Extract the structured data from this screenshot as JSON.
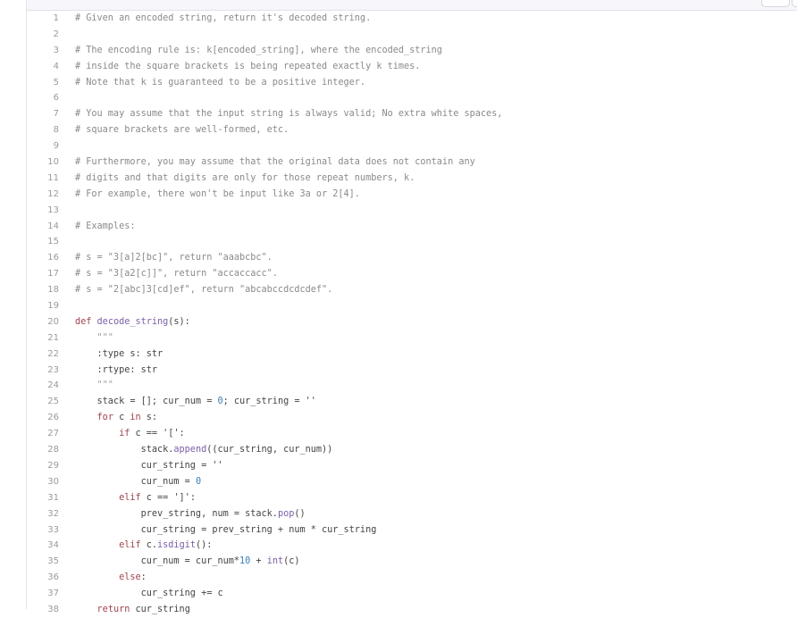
{
  "editor": {
    "language": "python",
    "colors": {
      "comment": "#8a8a8a",
      "keyword": "#a1434f",
      "function": "#7b5ea7",
      "number": "#3b7fb8",
      "text": "#444444",
      "line_number": "#9a9a9a",
      "header_bg": "#f6f6fb"
    },
    "lines": [
      {
        "n": "1",
        "text": "# Given an encoded string, return it's decoded string."
      },
      {
        "n": "2",
        "text": ""
      },
      {
        "n": "3",
        "text": "# The encoding rule is: k[encoded_string], where the encoded_string"
      },
      {
        "n": "4",
        "text": "# inside the square brackets is being repeated exactly k times."
      },
      {
        "n": "5",
        "text": "# Note that k is guaranteed to be a positive integer."
      },
      {
        "n": "6",
        "text": ""
      },
      {
        "n": "7",
        "text": "# You may assume that the input string is always valid; No extra white spaces,"
      },
      {
        "n": "8",
        "text": "# square brackets are well-formed, etc."
      },
      {
        "n": "9",
        "text": ""
      },
      {
        "n": "10",
        "text": "# Furthermore, you may assume that the original data does not contain any"
      },
      {
        "n": "11",
        "text": "# digits and that digits are only for those repeat numbers, k."
      },
      {
        "n": "12",
        "text": "# For example, there won't be input like 3a or 2[4]."
      },
      {
        "n": "13",
        "text": ""
      },
      {
        "n": "14",
        "text": "# Examples:"
      },
      {
        "n": "15",
        "text": ""
      },
      {
        "n": "16",
        "text": "# s = \"3[a]2[bc]\", return \"aaabcbc\"."
      },
      {
        "n": "17",
        "text": "# s = \"3[a2[c]]\", return \"accaccacc\"."
      },
      {
        "n": "18",
        "text": "# s = \"2[abc]3[cd]ef\", return \"abcabccdcdcdef\"."
      },
      {
        "n": "19",
        "text": ""
      },
      {
        "n": "20",
        "text": "def decode_string(s):"
      },
      {
        "n": "21",
        "text": "    \"\"\""
      },
      {
        "n": "22",
        "text": "    :type s: str"
      },
      {
        "n": "23",
        "text": "    :rtype: str"
      },
      {
        "n": "24",
        "text": "    \"\"\""
      },
      {
        "n": "25",
        "text": "    stack = []; cur_num = 0; cur_string = ''"
      },
      {
        "n": "26",
        "text": "    for c in s:"
      },
      {
        "n": "27",
        "text": "        if c == '[':"
      },
      {
        "n": "28",
        "text": "            stack.append((cur_string, cur_num))"
      },
      {
        "n": "29",
        "text": "            cur_string = ''"
      },
      {
        "n": "30",
        "text": "            cur_num = 0"
      },
      {
        "n": "31",
        "text": "        elif c == ']':"
      },
      {
        "n": "32",
        "text": "            prev_string, num = stack.pop()"
      },
      {
        "n": "33",
        "text": "            cur_string = prev_string + num * cur_string"
      },
      {
        "n": "34",
        "text": "        elif c.isdigit():"
      },
      {
        "n": "35",
        "text": "            cur_num = cur_num*10 + int(c)"
      },
      {
        "n": "36",
        "text": "        else:"
      },
      {
        "n": "37",
        "text": "            cur_string += c"
      },
      {
        "n": "38",
        "text": "    return cur_string"
      }
    ]
  }
}
